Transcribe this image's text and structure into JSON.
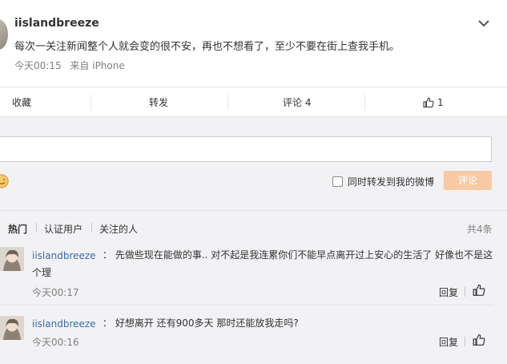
{
  "post": {
    "username": "iislandbreeze",
    "text": "每次一关注新闻整个人就会变的很不安，再也不想看了，至少不要在街上查我手机。",
    "time": "今天00:15",
    "source": "来自 iPhone"
  },
  "actions": {
    "favorite": "收藏",
    "repost": "转发",
    "comment": "评论 4",
    "like_count": "1"
  },
  "reply_box": {
    "input_value": "",
    "repost_label": "同时转发到我的微博",
    "submit_label": "评论"
  },
  "filters": {
    "items": [
      "热门",
      "认证用户",
      "关注的人"
    ],
    "total": "共4条"
  },
  "comments": [
    {
      "username": "iislandbreeze",
      "text": "：  先做些现在能做的事.. 对不起是我连累你们不能早点离开过上安心的生活了 好像也不是这个理",
      "time": "今天00:17",
      "reply_label": "回复"
    },
    {
      "username": "iislandbreeze",
      "text": "：  好想离开 还有900多天 那时还能放我走吗?",
      "time": "今天00:16",
      "reply_label": "回复"
    }
  ],
  "colors": {
    "accent_orange": "#f8c9a5",
    "link_blue": "#3c6aa6",
    "panel_bg": "#f2f2f5"
  },
  "icons": {
    "chevron": "chevron-down-icon",
    "like": "thumbs-up-icon",
    "emoji": "smile-icon"
  }
}
